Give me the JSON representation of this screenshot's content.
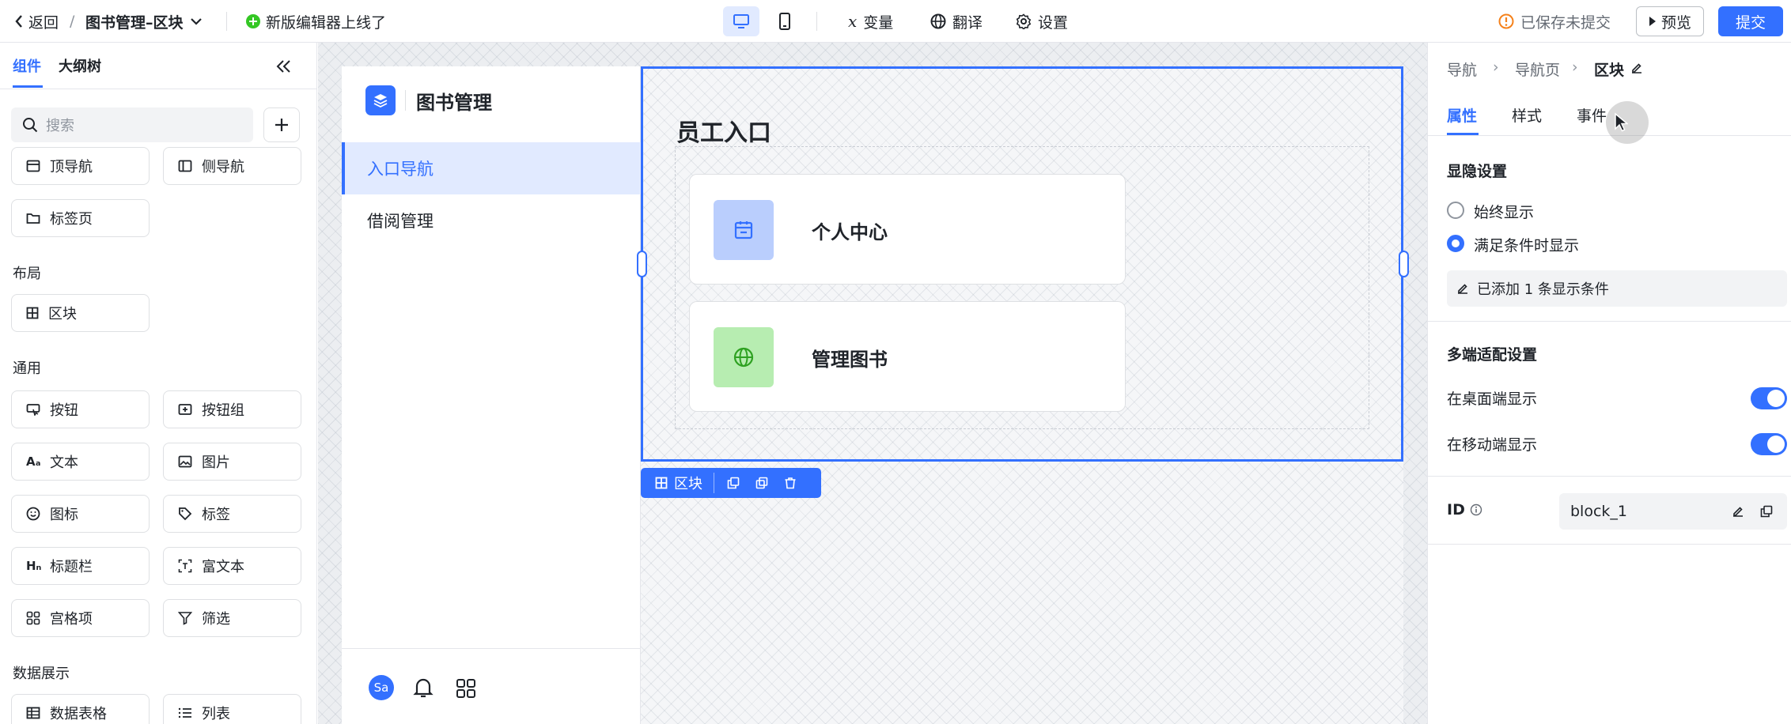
{
  "topbar": {
    "back": "返回",
    "separator": "/",
    "page_title": "图书管理–区块",
    "notice": "新版编辑器上线了",
    "variable": "变量",
    "translate": "翻译",
    "settings": "设置",
    "save_status": "已保存未提交",
    "preview": "预览",
    "submit": "提交"
  },
  "left": {
    "tabs": [
      "组件",
      "大纲树"
    ],
    "search_placeholder": "搜索",
    "row0": [
      {
        "label": "顶导航",
        "icon": "top-nav-icon"
      },
      {
        "label": "侧导航",
        "icon": "side-nav-icon"
      }
    ],
    "row1": [
      {
        "label": "标签页",
        "icon": "folder-icon"
      }
    ],
    "sections": [
      "布局",
      "通用",
      "数据展示"
    ],
    "layout_items": [
      {
        "label": "区块",
        "icon": "grid-icon"
      }
    ],
    "general_items": [
      {
        "label": "按钮",
        "icon": "button-icon"
      },
      {
        "label": "按钮组",
        "icon": "button-group-icon"
      },
      {
        "label": "文本",
        "icon": "text-icon"
      },
      {
        "label": "图片",
        "icon": "image-icon"
      },
      {
        "label": "图标",
        "icon": "smile-icon"
      },
      {
        "label": "标签",
        "icon": "tag-icon"
      },
      {
        "label": "标题栏",
        "icon": "heading-icon"
      },
      {
        "label": "富文本",
        "icon": "rich-text-icon"
      },
      {
        "label": "宫格项",
        "icon": "grid-item-icon"
      },
      {
        "label": "筛选",
        "icon": "filter-icon"
      }
    ],
    "data_items": [
      {
        "label": "数据表格",
        "icon": "table-icon"
      },
      {
        "label": "列表",
        "icon": "list-icon"
      }
    ]
  },
  "app": {
    "name": "图书管理",
    "nav": [
      "入口导航",
      "借阅管理"
    ],
    "avatar": "Sa",
    "block_title": "员工入口",
    "cards": [
      {
        "label": "个人中心",
        "icon": "calendar-icon"
      },
      {
        "label": "管理图书",
        "icon": "globe-icon"
      }
    ],
    "toolbar_label": "区块"
  },
  "right": {
    "breadcrumb": [
      "导航",
      "导航页",
      "区块"
    ],
    "tabs": [
      "属性",
      "样式",
      "事件"
    ],
    "visibility_title": "显隐设置",
    "always_show": "始终显示",
    "conditional_show": "满足条件时显示",
    "condition_count": "已添加 1 条显示条件",
    "multi_title": "多端适配设置",
    "desktop_show": "在桌面端显示",
    "mobile_show": "在移动端显示",
    "desktop_enabled": true,
    "mobile_enabled": true,
    "id_label": "ID",
    "id_value": "block_1"
  },
  "colors": {
    "accent": "#3370ff",
    "warning": "#f5811a",
    "success": "#34c724"
  }
}
